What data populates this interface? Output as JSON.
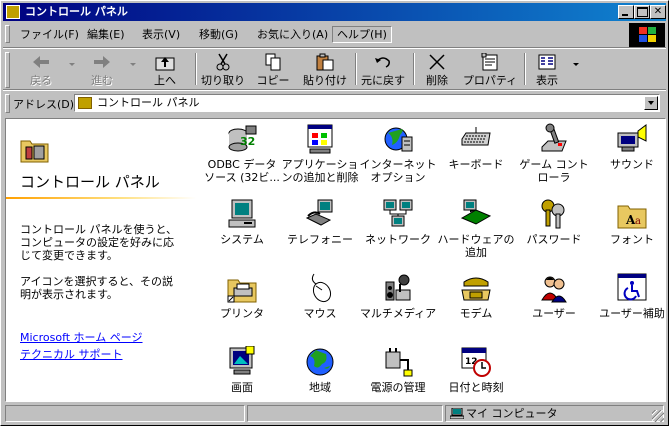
{
  "window": {
    "title": "コントロール パネル"
  },
  "menu": [
    "ファイル(F)",
    "編集(E)",
    "表示(V)",
    "移動(G)",
    "お気に入り(A)",
    "ヘルプ(H)"
  ],
  "toolbar": {
    "back": "戻る",
    "forward": "進む",
    "up": "上へ",
    "cut": "切り取り",
    "copy": "コピー",
    "paste": "貼り付け",
    "undo": "元に戻す",
    "delete": "削除",
    "properties": "プロパティ",
    "views": "表示"
  },
  "address": {
    "label": "アドレス(D)",
    "value": "コントロール パネル"
  },
  "left_pane": {
    "title": "コントロール パネル",
    "desc1": "コントロール パネルを使うと、コンピュータの設定を好みに応じて変更できます。",
    "desc2": "アイコンを選択すると、その説明が表示されます。",
    "link1": "Microsoft ホーム ページ",
    "link2": "テクニカル サポート"
  },
  "items": [
    {
      "label": "ODBC データ ソース (32ビ...",
      "icon": "odbc-icon"
    },
    {
      "label": "アプリケーションの追加と削除",
      "icon": "add-remove-programs-icon"
    },
    {
      "label": "インターネット オプション",
      "icon": "internet-options-icon"
    },
    {
      "label": "キーボード",
      "icon": "keyboard-icon"
    },
    {
      "label": "ゲーム コントローラ",
      "icon": "joystick-icon"
    },
    {
      "label": "サウンド",
      "icon": "sound-icon"
    },
    {
      "label": "システム",
      "icon": "system-icon"
    },
    {
      "label": "テレフォニー",
      "icon": "telephony-icon"
    },
    {
      "label": "ネットワーク",
      "icon": "network-icon"
    },
    {
      "label": "ハードウェアの追加",
      "icon": "add-hardware-icon"
    },
    {
      "label": "パスワード",
      "icon": "passwords-icon"
    },
    {
      "label": "フォント",
      "icon": "fonts-icon"
    },
    {
      "label": "プリンタ",
      "icon": "printers-icon"
    },
    {
      "label": "マウス",
      "icon": "mouse-icon"
    },
    {
      "label": "マルチメディア",
      "icon": "multimedia-icon"
    },
    {
      "label": "モデム",
      "icon": "modem-icon"
    },
    {
      "label": "ユーザー",
      "icon": "users-icon"
    },
    {
      "label": "ユーザー補助",
      "icon": "accessibility-icon"
    },
    {
      "label": "画面",
      "icon": "display-icon"
    },
    {
      "label": "地域",
      "icon": "regional-settings-icon"
    },
    {
      "label": "電源の管理",
      "icon": "power-management-icon"
    },
    {
      "label": "日付と時刻",
      "icon": "date-time-icon"
    }
  ],
  "status": {
    "zone": "マイ コンピュータ"
  },
  "colors": {
    "title_start": "#000080",
    "title_end": "#1084d0",
    "link": "#0000ff"
  }
}
